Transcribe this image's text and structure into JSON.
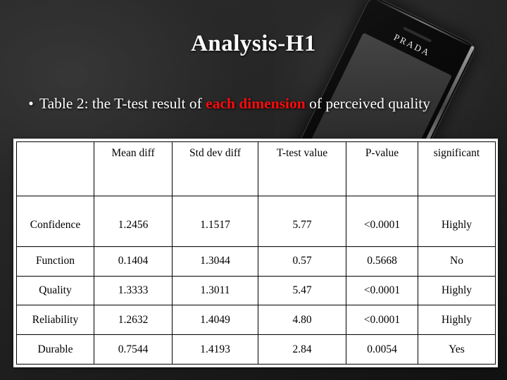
{
  "slide": {
    "title": "Analysis-H1",
    "bullet": {
      "marker": "•",
      "prefix": "Table 2: the T-test result of ",
      "highlight": "each dimension",
      "suffix": " of perceived quality"
    }
  },
  "decor": {
    "phone_brand": "PRADA"
  },
  "colors": {
    "highlight_red": "#ff0b0b",
    "negative_red": "#c0392b",
    "table_background": "#ffffff",
    "table_border": "#000000",
    "text_light": "#ffffff"
  },
  "table": {
    "headers": [
      "",
      "Mean diff",
      "Std dev diff",
      "T-test value",
      "P-value",
      "significant"
    ],
    "rows": [
      {
        "dimension": "Confidence",
        "mean_diff": "1.2456",
        "std_dev_diff": "1.1517",
        "t_test_value": "5.77",
        "p_value": "<0.0001",
        "significant": "Highly",
        "negative": false
      },
      {
        "dimension": "Function",
        "mean_diff": "0.1404",
        "std_dev_diff": "1.3044",
        "t_test_value": "0.57",
        "p_value": "0.5668",
        "significant": "No",
        "negative": true
      },
      {
        "dimension": "Quality",
        "mean_diff": "1.3333",
        "std_dev_diff": "1.3011",
        "t_test_value": "5.47",
        "p_value": "<0.0001",
        "significant": "Highly",
        "negative": false
      },
      {
        "dimension": "Reliability",
        "mean_diff": "1.2632",
        "std_dev_diff": "1.4049",
        "t_test_value": "4.80",
        "p_value": "<0.0001",
        "significant": "Highly",
        "negative": false
      },
      {
        "dimension": "Durable",
        "mean_diff": "0.7544",
        "std_dev_diff": "1.4193",
        "t_test_value": "2.84",
        "p_value": "0.0054",
        "significant": "Yes",
        "negative": false
      }
    ]
  }
}
